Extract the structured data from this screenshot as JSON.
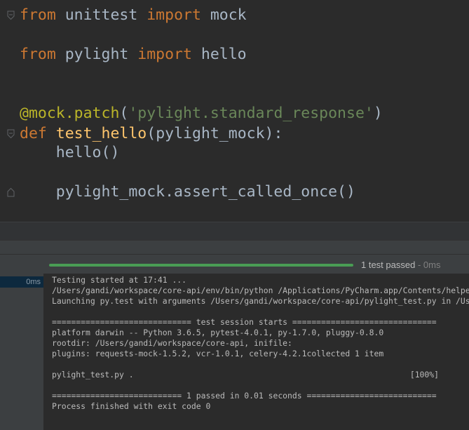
{
  "editor": {
    "line1": {
      "kw_from": "from",
      "module": " unittest ",
      "kw_import": "import",
      "name": " mock"
    },
    "line2": {
      "kw_from": "from",
      "module": " pylight ",
      "kw_import": "import",
      "name": " hello"
    },
    "line3": {
      "decorator": "@mock.patch",
      "open": "(",
      "string": "'pylight.standard_response'",
      "close": ")"
    },
    "line4": {
      "kw_def": "def",
      "space": " ",
      "fn_name": "test_hello",
      "params": "(pylight_mock):"
    },
    "line5": "    hello()",
    "line6": "    pylight_mock.assert_called_once()"
  },
  "test_status": {
    "progress": 1.0,
    "progress_color": "#499c54",
    "summary": "1 test passed",
    "separator": " - ",
    "duration": "0ms"
  },
  "test_tree": {
    "selected_row_time": "0ms"
  },
  "console": {
    "lines": [
      "Testing started at 17:41 ...",
      "/Users/gandi/workspace/core-api/env/bin/python /Applications/PyCharm.app/Contents/helpers/pycharm/_jb_pytest_runner.py",
      "Launching py.test with arguments /Users/gandi/workspace/core-api/pylight_test.py in /Users/gandi/workspace/core-api",
      "============================= test session starts ==============================",
      "platform darwin -- Python 3.6.5, pytest-4.0.1, py-1.7.0, pluggy-0.8.0",
      "rootdir: /Users/gandi/workspace/core-api, inifile:",
      "plugins: requests-mock-1.5.2, vcr-1.0.1, celery-4.2.1collected 1 item",
      "pylight_test.py .",
      "[100%]",
      "=========================== 1 passed in 0.01 seconds ===========================",
      "Process finished with exit code 0"
    ]
  },
  "colors": {
    "keyword": "#cc7832",
    "decorator": "#bbb529",
    "string": "#6a8759",
    "function": "#ffc66d",
    "text": "#a9b7c6",
    "background": "#2b2b2b"
  },
  "icons": [
    "fold-marker-icon"
  ]
}
